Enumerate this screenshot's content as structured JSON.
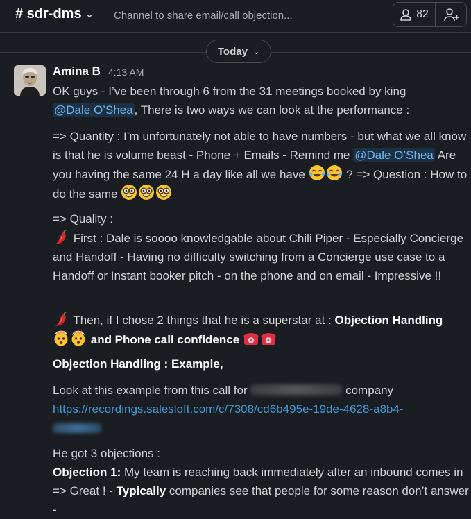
{
  "header": {
    "channel_name": "# sdr-dms",
    "topic": "Channel to share email/call objection...",
    "member_count": "82"
  },
  "date_divider": {
    "label": "Today"
  },
  "message": {
    "sender": "Amina B",
    "time": "4:13 AM",
    "p1": {
      "text1": "OK guys - I’ve been through 6 from the 31 meetings booked by king",
      "mention": "@Dale O’Shea",
      "text2": ", There is two ways we can look at the performance :"
    },
    "p2": {
      "text1": "=> Quantity : I’m unfortunately not able to have numbers - but what we all know is that he is volume beast - Phone + Emails - Remind me",
      "mention": "@Dale O’Shea",
      "text2": "Are you having the same 24 H a day like all we have",
      "text3": "? => Question : How to do the same"
    },
    "p3": {
      "heading": "=> Quality :",
      "text": "First : Dale is soooo knowledgable about Chili Piper - Especially Concierge and Handoff - Having no difficulty switching from a Concierge use case to a Handoff or Instant booker pitch - on the phone and on email - Impressive !!"
    },
    "p4": {
      "text1": "Then, if I chose 2 things that he is a superstar at :",
      "bold1": "Objection Handling",
      "bold2": "and Phone call confidence"
    },
    "p5": {
      "bold": "Objection Handling : Example,"
    },
    "p6": {
      "text1": "Look at this example from this call for",
      "text2": "company",
      "link": "https://recordings.salesloft.com/c/7308/cd6b495e-19de-4628-a8b4-"
    },
    "p7": {
      "text": "He got 3 objections :",
      "bold1": "Objection 1:",
      "text1": "My team is reaching back immediately after an inbound comes in => Great ! -",
      "bold2": "Typically",
      "text2": "companies see that people for some reason don’t answer -"
    }
  },
  "icons": {
    "person": "person-icon",
    "add_user": "add-user-icon",
    "emoji_laugh": "joy-emoji",
    "emoji_nerd": "nerd-emoji",
    "emoji_pepper": "hot-pepper-emoji",
    "emoji_exploding": "exploding-head-emoji",
    "emoji_phone": "telephone-emoji"
  }
}
